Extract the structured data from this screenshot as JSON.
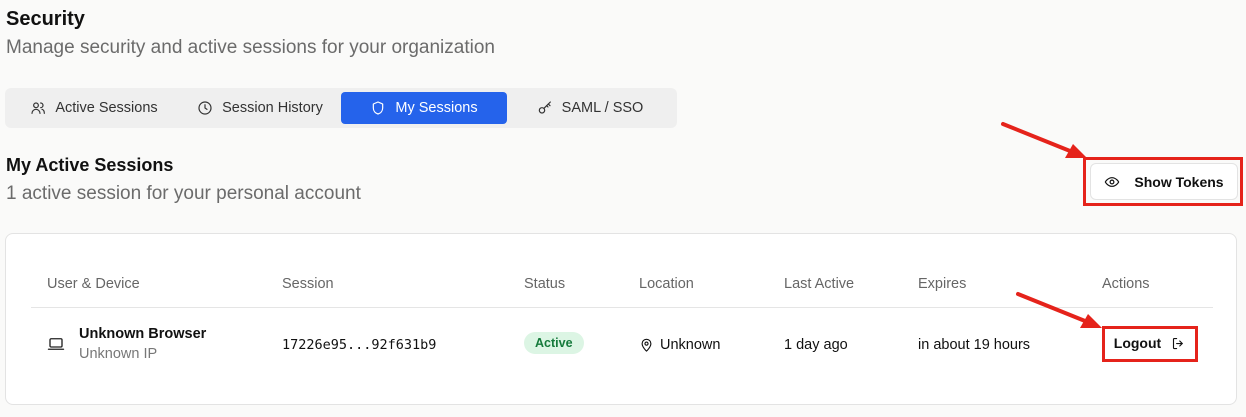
{
  "header": {
    "title": "Security",
    "subtitle": "Manage security and active sessions for your organization"
  },
  "tabs": [
    {
      "label": "Active Sessions",
      "icon": "users-icon",
      "active": false
    },
    {
      "label": "Session History",
      "icon": "clock-icon",
      "active": false
    },
    {
      "label": "My Sessions",
      "icon": "shield-icon",
      "active": true
    },
    {
      "label": "SAML / SSO",
      "icon": "key-icon",
      "active": false
    }
  ],
  "section": {
    "title": "My Active Sessions",
    "subtitle": "1 active session for your personal account",
    "show_tokens_label": "Show Tokens"
  },
  "table": {
    "columns": [
      "User & Device",
      "Session",
      "Status",
      "Location",
      "Last Active",
      "Expires",
      "Actions"
    ],
    "rows": [
      {
        "device_icon": "laptop-icon",
        "browser": "Unknown Browser",
        "ip": "Unknown IP",
        "session": "17226e95...92f631b9",
        "status": "Active",
        "location": "Unknown",
        "last_active": "1 day ago",
        "expires": "in about 19 hours",
        "action_label": "Logout"
      }
    ]
  },
  "colors": {
    "accent": "#2563eb",
    "status_active_bg": "#dcf5e4",
    "status_active_text": "#157a3b",
    "annotation_red": "#e5231b"
  }
}
